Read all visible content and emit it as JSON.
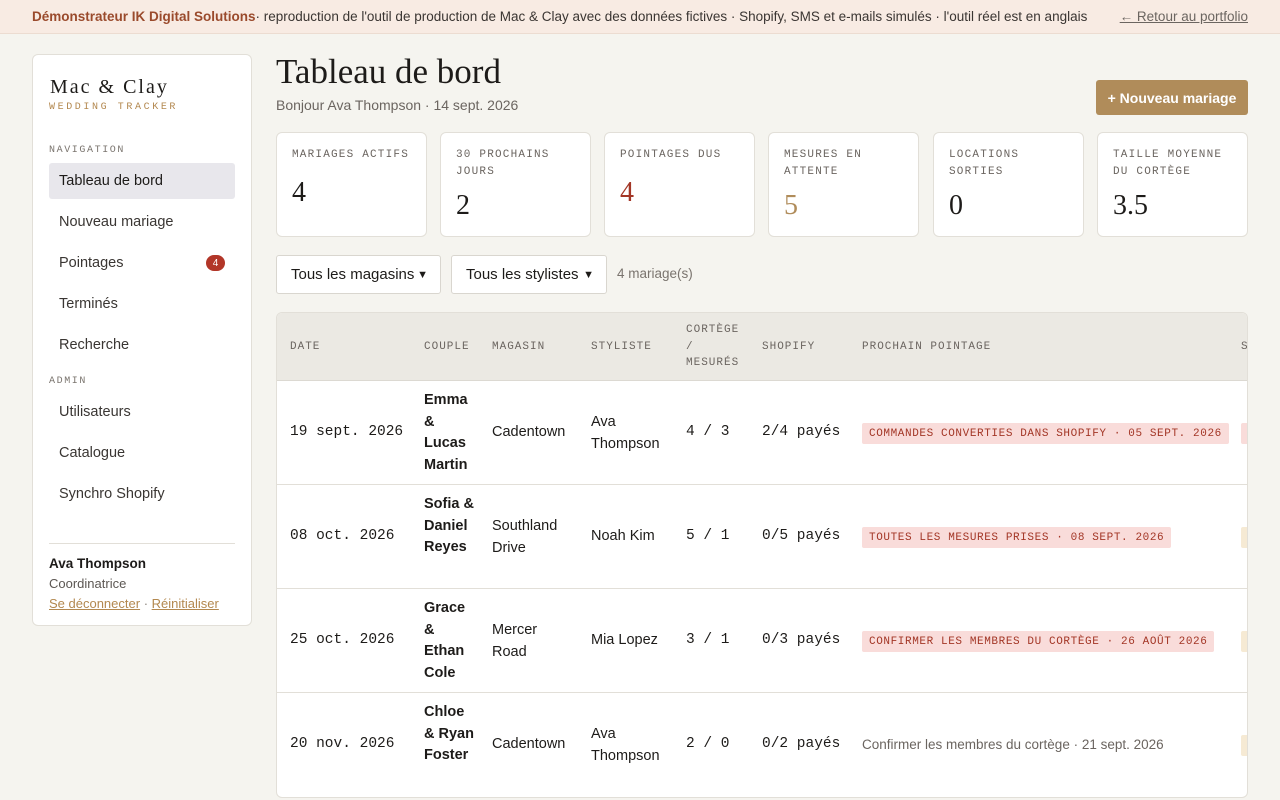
{
  "banner": {
    "brand": "Démonstrateur IK Digital Solutions",
    "text": " · reproduction de l'outil de production de Mac & Clay avec des données fictives · Shopify, SMS et e-mails simulés · l'outil réel est en anglais",
    "back_link": "← Retour au portfolio"
  },
  "sidebar": {
    "logo": "Mac & Clay",
    "logo_sub": "WEDDING TRACKER",
    "nav_label": "NAVIGATION",
    "items": [
      {
        "label": "Tableau de bord"
      },
      {
        "label": "Nouveau mariage"
      },
      {
        "label": "Pointages",
        "badge": "4"
      },
      {
        "label": "Terminés"
      },
      {
        "label": "Recherche"
      }
    ],
    "admin_label": "ADMIN",
    "admin_items": [
      {
        "label": "Utilisateurs"
      },
      {
        "label": "Catalogue"
      },
      {
        "label": "Synchro Shopify"
      }
    ],
    "user": {
      "name": "Ava Thompson",
      "role": "Coordinatrice",
      "logout": "Se déconnecter",
      "sep": " · ",
      "reset": "Réinitialiser"
    }
  },
  "header": {
    "title": "Tableau de bord",
    "subtitle": "Bonjour Ava Thompson · 14 sept. 2026",
    "new_button": "+ Nouveau mariage"
  },
  "stats": [
    {
      "label": "MARIAGES ACTIFS",
      "value": "4"
    },
    {
      "label": "30 PROCHAINS JOURS",
      "value": "2"
    },
    {
      "label": "POINTAGES DUS",
      "value": "4"
    },
    {
      "label": "MESURES EN ATTENTE",
      "value": "5"
    },
    {
      "label": "LOCATIONS SORTIES",
      "value": "0"
    },
    {
      "label": "TAILLE MOYENNE DU CORTÈGE",
      "value": "3.5"
    }
  ],
  "filters": {
    "store": "Tous les magasins",
    "stylist": "Tous les stylistes",
    "count": "4 mariage(s)"
  },
  "table": {
    "columns": [
      "DATE",
      "COUPLE",
      "MAGASIN",
      "STYLISTE",
      "CORTÈGE / MESURÉS",
      "SHOPIFY",
      "PROCHAIN POINTAGE",
      "S"
    ],
    "rows": [
      {
        "date": "19 sept. 2026",
        "couple": "Emma & Lucas Martin",
        "store": "Cadentown",
        "stylist": "Ava Thompson",
        "party": "4 / 3",
        "shopify": "2/4 payés",
        "next": "COMMANDES CONVERTIES DANS SHOPIFY · 05 SEPT. 2026",
        "overdue": true
      },
      {
        "date": "08 oct. 2026",
        "couple": "Sofia & Daniel Reyes",
        "store": "Southland Drive",
        "stylist": "Noah Kim",
        "party": "5 / 1",
        "shopify": "0/5 payés",
        "next": "TOUTES LES MESURES PRISES · 08 SEPT. 2026",
        "overdue": true
      },
      {
        "date": "25 oct. 2026",
        "couple": "Grace & Ethan Cole",
        "store": "Mercer Road",
        "stylist": "Mia Lopez",
        "party": "3 / 1",
        "shopify": "0/3 payés",
        "next": "CONFIRMER LES MEMBRES DU CORTÈGE · 26 AOÛT 2026",
        "overdue": true
      },
      {
        "date": "20 nov. 2026",
        "couple": "Chloe & Ryan Foster",
        "store": "Cadentown",
        "stylist": "Ava Thompson",
        "party": "2 / 0",
        "shopify": "0/2 payés",
        "next": "Confirmer les membres du cortège · 21 sept. 2026",
        "overdue": false
      }
    ]
  },
  "colors": {
    "accent": "#b08c5a",
    "danger": "#a33626",
    "banner_bg": "#f8ebe3",
    "page_bg": "#f5f4ef"
  }
}
